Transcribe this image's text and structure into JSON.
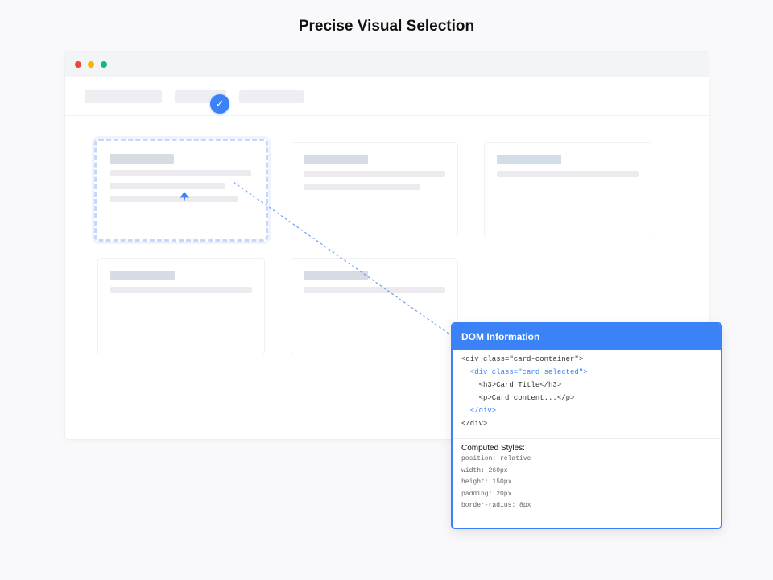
{
  "page": {
    "title": "Precise Visual Selection"
  },
  "browser": {
    "window_controls": [
      "close",
      "minimize",
      "maximize"
    ],
    "nav_placeholders": 3,
    "selected_nav_icon": "check-icon"
  },
  "dom_panel": {
    "header": "DOM Information",
    "code_lines": [
      "<div class=\"card-container\">",
      "  <div class=\"card selected\">",
      "    <h3>Card Title</h3>",
      "    <p>Card content...</p>",
      "  </div>",
      "</div>"
    ],
    "styles_title": "Computed Styles:",
    "styles": [
      "position: relative",
      "width: 260px",
      "height: 150px",
      "padding: 20px",
      "border-radius: 8px"
    ]
  },
  "colors": {
    "accent": "#3b82f6",
    "close": "#ef4444",
    "minimize": "#f5b800",
    "maximize": "#10b981"
  }
}
